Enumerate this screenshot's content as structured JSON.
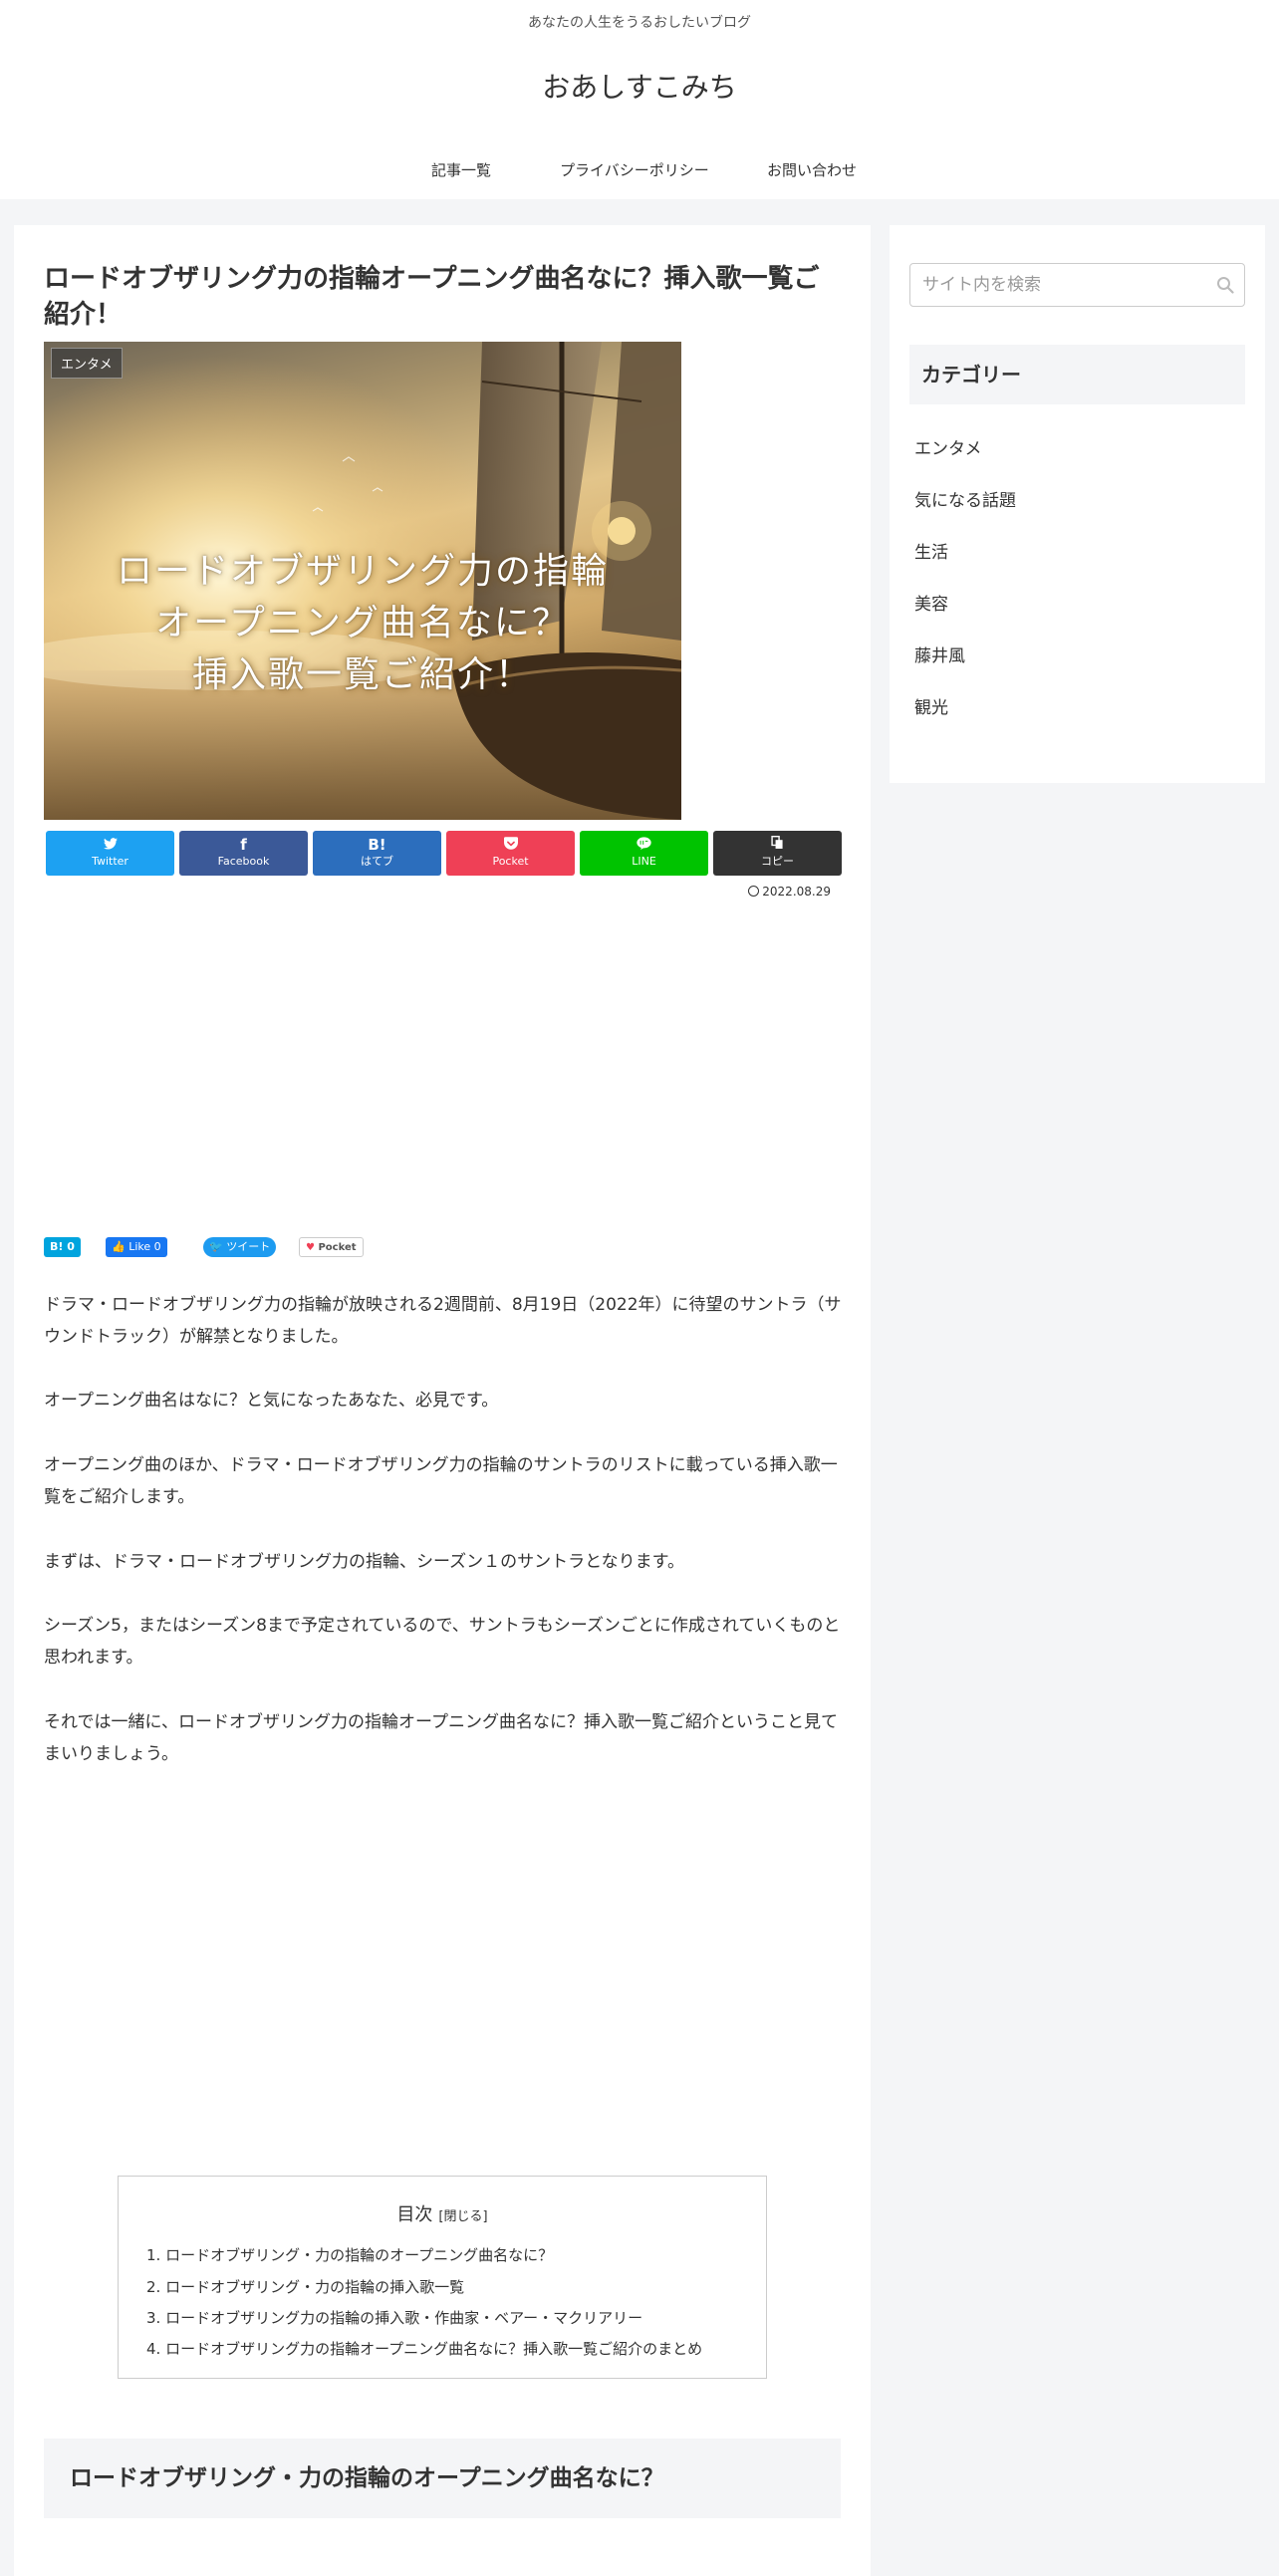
{
  "header": {
    "tagline": "あなたの人生をうるおしたいブログ",
    "site_title": "おあしすこみち",
    "nav": [
      "記事一覧",
      "プライバシーポリシー",
      "お問い合わせ"
    ]
  },
  "article": {
    "title": "ロードオブザリング力の指輪オープニング曲名なに？挿入歌一覧ご紹介！",
    "category": "エンタメ",
    "eyecatch_lines": [
      "ロードオブザリング力の指輪",
      "オープニング曲名なに？",
      "挿入歌一覧ご紹介！"
    ],
    "date": "2022.08.29",
    "share": [
      {
        "icon": "twitter-icon",
        "glyph": "🐦",
        "label": "Twitter",
        "color": "#1da1f2"
      },
      {
        "icon": "facebook-icon",
        "glyph": "f",
        "label": "Facebook",
        "color": "#3b5998"
      },
      {
        "icon": "hatena-icon",
        "glyph": "B!",
        "label": "はてブ",
        "color": "#2c6ebd"
      },
      {
        "icon": "pocket-icon",
        "glyph": "♥",
        "label": "Pocket",
        "color": "#ef4056"
      },
      {
        "icon": "line-icon",
        "glyph": "●",
        "label": "LINE",
        "color": "#00c300"
      },
      {
        "icon": "copy-icon",
        "glyph": "⎘",
        "label": "コピー",
        "color": "#333333"
      }
    ],
    "counters": {
      "hatena": "B! 0",
      "facebook": "Like 0",
      "twitter": "ツイート",
      "pocket": "Pocket"
    },
    "paragraphs": [
      "ドラマ・ロードオブザリング力の指輪が放映される2週間前、8月19日（2022年）に待望のサントラ（サウンドトラック）が解禁となりました。",
      "オープニング曲名はなに？と気になったあなた、必見です。",
      "オープニング曲のほか、ドラマ・ロードオブザリング力の指輪のサントラのリストに載っている挿入歌一覧をご紹介します。",
      "まずは、ドラマ・ロードオブザリング力の指輪、シーズン１のサントラとなります。",
      "シーズン5，またはシーズン8まで予定されているので、サントラもシーズンごとに作成されていくものと思われます。",
      "それでは一緒に、ロードオブザリング力の指輪オープニング曲名なに？挿入歌一覧ご紹介ということ見てまいりましょう。"
    ],
    "toc": {
      "title": "目次",
      "close": "[閉じる]",
      "items": [
        "1. ロードオブザリング・力の指輪のオープニング曲名なに？",
        "2. ロードオブザリング・力の指輪の挿入歌一覧",
        "3. ロードオブザリング力の指輪の挿入歌・作曲家・ベアー・マクリアリー",
        "4. ロードオブザリング力の指輪オープニング曲名なに？挿入歌一覧ご紹介のまとめ"
      ]
    },
    "section_heading": "ロードオブザリング・力の指輪のオープニング曲名なに？"
  },
  "sidebar": {
    "search_placeholder": "サイト内を検索",
    "widget_title": "カテゴリー",
    "categories": [
      "エンタメ",
      "気になる話題",
      "生活",
      "美容",
      "藤井風",
      "観光"
    ]
  }
}
